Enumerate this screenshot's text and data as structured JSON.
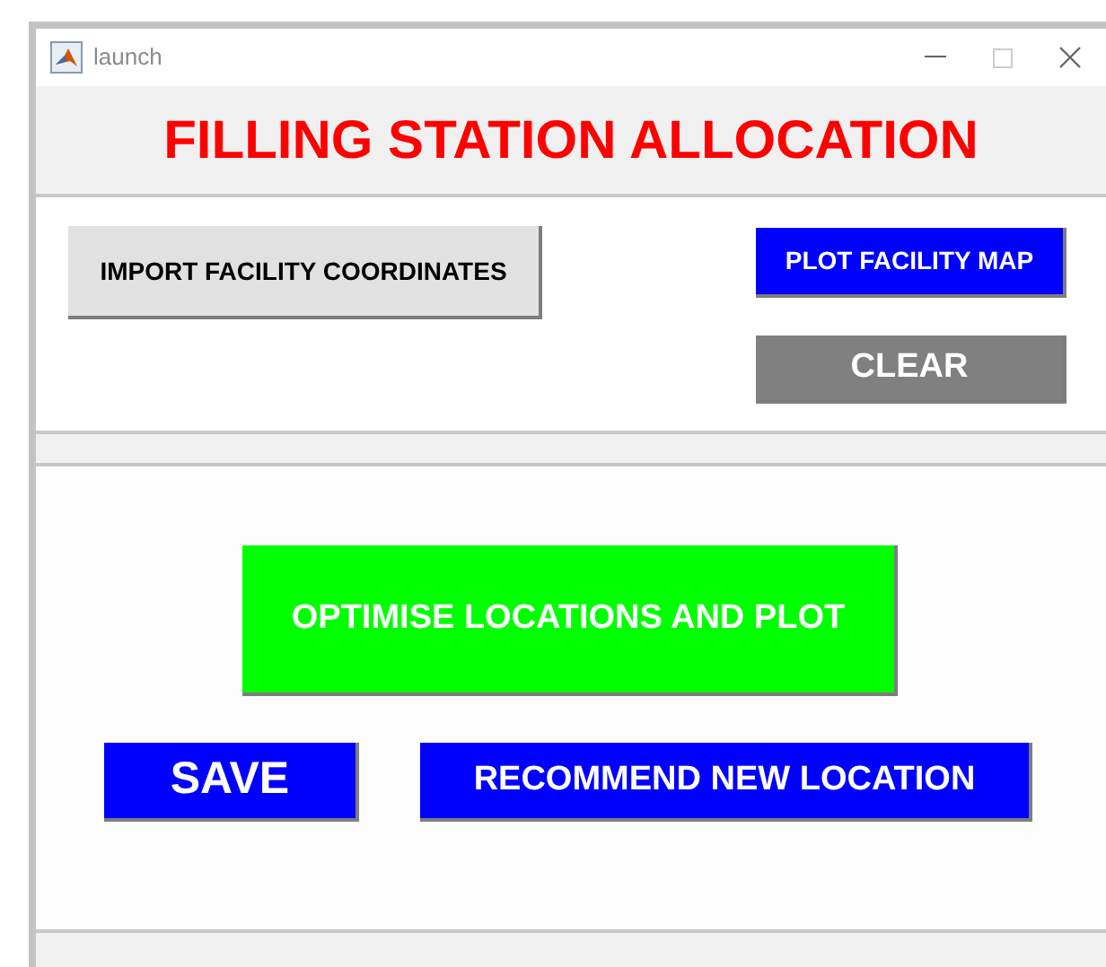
{
  "window": {
    "title": "launch"
  },
  "header": {
    "title": "FILLING STATION ALLOCATION"
  },
  "data_panel": {
    "buttons": [
      {
        "label": "IMPORT FACILITY COORDINATES",
        "color": "#e1e1e1"
      },
      {
        "label": "PLOT FACILITY MAP",
        "color": "#0000ff"
      },
      {
        "label": "CLEAR",
        "color": "#808080"
      }
    ]
  },
  "analysis_panel": {
    "buttons": [
      {
        "label": "OPTIMISE LOCATIONS AND PLOT",
        "color": "#00ff00"
      },
      {
        "label": "SAVE",
        "color": "#0000ff"
      },
      {
        "label": "RECOMMEND NEW LOCATION",
        "color": "#0000ff"
      }
    ]
  }
}
